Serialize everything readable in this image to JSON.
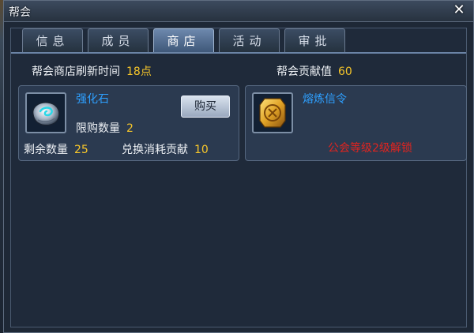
{
  "window": {
    "title": "帮会",
    "close_icon": "close-icon"
  },
  "tabs": [
    {
      "label": "信息",
      "active": false
    },
    {
      "label": "成员",
      "active": false
    },
    {
      "label": "商店",
      "active": true
    },
    {
      "label": "活动",
      "active": false
    },
    {
      "label": "审批",
      "active": false
    }
  ],
  "shop": {
    "refresh_label": "帮会商店刷新时间",
    "refresh_value": "18点",
    "contribution_label": "帮会贡献值",
    "contribution_value": "60"
  },
  "items": [
    {
      "name": "强化石",
      "icon": "reinforce-stone-icon",
      "limit_label": "限购数量",
      "limit_value": "2",
      "remaining_label": "剩余数量",
      "remaining_value": "25",
      "cost_label": "兑换消耗贡献",
      "cost_value": "10",
      "buy_label": "购买"
    },
    {
      "name": "熔炼信令",
      "icon": "smelting-token-icon",
      "lock_text": "公会等级2级解锁"
    }
  ],
  "colors": {
    "accent_value": "#f6c62a",
    "item_name": "#2ea0ff",
    "locked": "#e0241f"
  }
}
